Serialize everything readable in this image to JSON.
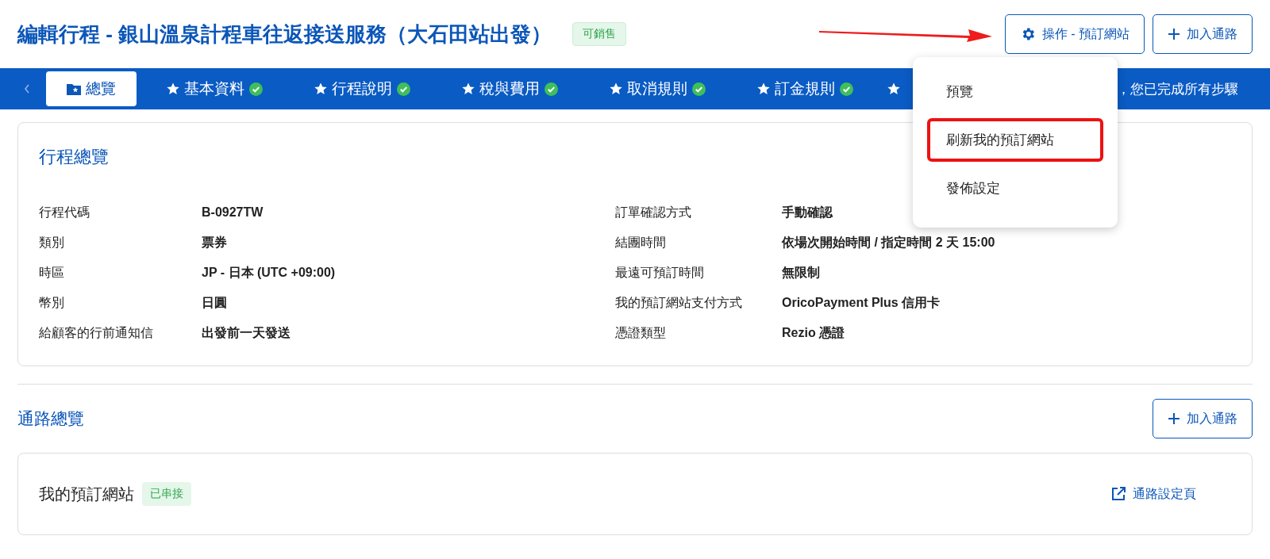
{
  "header": {
    "title": "編輯行程 - 銀山溫泉計程車往返接送服務（大石田站出發）",
    "status_badge": "可銷售",
    "actions_button": "操作 - 預訂網站",
    "add_channel_button": "加入通路"
  },
  "tabs": [
    {
      "label": "總覽",
      "selected": true,
      "done": false
    },
    {
      "label": "基本資料",
      "selected": false,
      "done": true
    },
    {
      "label": "行程說明",
      "selected": false,
      "done": true
    },
    {
      "label": "稅與費用",
      "selected": false,
      "done": true
    },
    {
      "label": "取消規則",
      "selected": false,
      "done": true
    },
    {
      "label": "訂金規則",
      "selected": false,
      "done": true
    }
  ],
  "completion_note": "，您已完成所有步驟",
  "dropdown": {
    "items": [
      {
        "label": "預覽",
        "highlighted": false
      },
      {
        "label": "刷新我的預訂網站",
        "highlighted": true
      },
      {
        "label": "發佈設定",
        "highlighted": false
      }
    ]
  },
  "overview": {
    "title": "行程總覽",
    "left": [
      {
        "label": "行程代碼",
        "value": "B-0927TW"
      },
      {
        "label": "類別",
        "value": "票券"
      },
      {
        "label": "時區",
        "value": "JP - 日本 (UTC +09:00)"
      },
      {
        "label": "幣別",
        "value": "日圓"
      },
      {
        "label": "給顧客的行前通知信",
        "value": "出發前一天發送"
      }
    ],
    "right": [
      {
        "label": "訂單確認方式",
        "value": "手動確認"
      },
      {
        "label": "結團時間",
        "value": "依場次開始時間 / 指定時間 2 天 15:00"
      },
      {
        "label": "最遠可預訂時間",
        "value": "無限制"
      },
      {
        "label": "我的預訂網站支付方式",
        "value": "OricoPayment Plus 信用卡"
      },
      {
        "label": "憑證類型",
        "value": "Rezio 憑證"
      }
    ]
  },
  "channels": {
    "title": "通路總覽",
    "add_button": "加入通路",
    "items": [
      {
        "name": "我的預訂網站",
        "status": "已串接",
        "link": "通路設定頁"
      }
    ]
  }
}
